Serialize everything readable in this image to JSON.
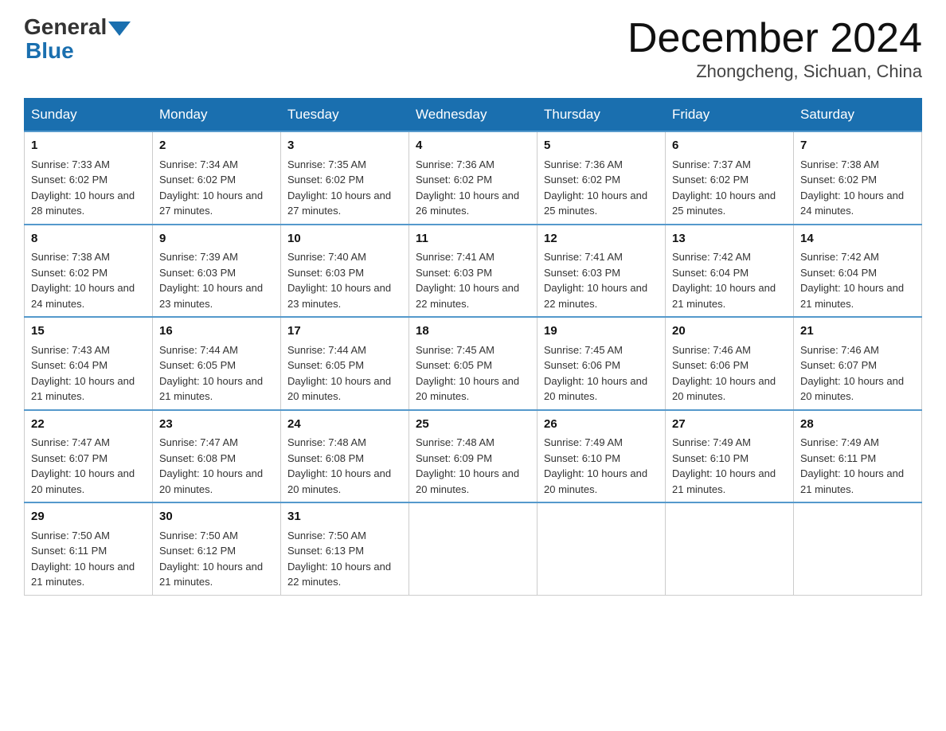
{
  "header": {
    "logo_text_general": "General",
    "logo_text_blue": "Blue",
    "month_year": "December 2024",
    "location": "Zhongcheng, Sichuan, China"
  },
  "weekdays": [
    "Sunday",
    "Monday",
    "Tuesday",
    "Wednesday",
    "Thursday",
    "Friday",
    "Saturday"
  ],
  "weeks": [
    [
      {
        "day": "1",
        "sunrise": "7:33 AM",
        "sunset": "6:02 PM",
        "daylight": "10 hours and 28 minutes."
      },
      {
        "day": "2",
        "sunrise": "7:34 AM",
        "sunset": "6:02 PM",
        "daylight": "10 hours and 27 minutes."
      },
      {
        "day": "3",
        "sunrise": "7:35 AM",
        "sunset": "6:02 PM",
        "daylight": "10 hours and 27 minutes."
      },
      {
        "day": "4",
        "sunrise": "7:36 AM",
        "sunset": "6:02 PM",
        "daylight": "10 hours and 26 minutes."
      },
      {
        "day": "5",
        "sunrise": "7:36 AM",
        "sunset": "6:02 PM",
        "daylight": "10 hours and 25 minutes."
      },
      {
        "day": "6",
        "sunrise": "7:37 AM",
        "sunset": "6:02 PM",
        "daylight": "10 hours and 25 minutes."
      },
      {
        "day": "7",
        "sunrise": "7:38 AM",
        "sunset": "6:02 PM",
        "daylight": "10 hours and 24 minutes."
      }
    ],
    [
      {
        "day": "8",
        "sunrise": "7:38 AM",
        "sunset": "6:02 PM",
        "daylight": "10 hours and 24 minutes."
      },
      {
        "day": "9",
        "sunrise": "7:39 AM",
        "sunset": "6:03 PM",
        "daylight": "10 hours and 23 minutes."
      },
      {
        "day": "10",
        "sunrise": "7:40 AM",
        "sunset": "6:03 PM",
        "daylight": "10 hours and 23 minutes."
      },
      {
        "day": "11",
        "sunrise": "7:41 AM",
        "sunset": "6:03 PM",
        "daylight": "10 hours and 22 minutes."
      },
      {
        "day": "12",
        "sunrise": "7:41 AM",
        "sunset": "6:03 PM",
        "daylight": "10 hours and 22 minutes."
      },
      {
        "day": "13",
        "sunrise": "7:42 AM",
        "sunset": "6:04 PM",
        "daylight": "10 hours and 21 minutes."
      },
      {
        "day": "14",
        "sunrise": "7:42 AM",
        "sunset": "6:04 PM",
        "daylight": "10 hours and 21 minutes."
      }
    ],
    [
      {
        "day": "15",
        "sunrise": "7:43 AM",
        "sunset": "6:04 PM",
        "daylight": "10 hours and 21 minutes."
      },
      {
        "day": "16",
        "sunrise": "7:44 AM",
        "sunset": "6:05 PM",
        "daylight": "10 hours and 21 minutes."
      },
      {
        "day": "17",
        "sunrise": "7:44 AM",
        "sunset": "6:05 PM",
        "daylight": "10 hours and 20 minutes."
      },
      {
        "day": "18",
        "sunrise": "7:45 AM",
        "sunset": "6:05 PM",
        "daylight": "10 hours and 20 minutes."
      },
      {
        "day": "19",
        "sunrise": "7:45 AM",
        "sunset": "6:06 PM",
        "daylight": "10 hours and 20 minutes."
      },
      {
        "day": "20",
        "sunrise": "7:46 AM",
        "sunset": "6:06 PM",
        "daylight": "10 hours and 20 minutes."
      },
      {
        "day": "21",
        "sunrise": "7:46 AM",
        "sunset": "6:07 PM",
        "daylight": "10 hours and 20 minutes."
      }
    ],
    [
      {
        "day": "22",
        "sunrise": "7:47 AM",
        "sunset": "6:07 PM",
        "daylight": "10 hours and 20 minutes."
      },
      {
        "day": "23",
        "sunrise": "7:47 AM",
        "sunset": "6:08 PM",
        "daylight": "10 hours and 20 minutes."
      },
      {
        "day": "24",
        "sunrise": "7:48 AM",
        "sunset": "6:08 PM",
        "daylight": "10 hours and 20 minutes."
      },
      {
        "day": "25",
        "sunrise": "7:48 AM",
        "sunset": "6:09 PM",
        "daylight": "10 hours and 20 minutes."
      },
      {
        "day": "26",
        "sunrise": "7:49 AM",
        "sunset": "6:10 PM",
        "daylight": "10 hours and 20 minutes."
      },
      {
        "day": "27",
        "sunrise": "7:49 AM",
        "sunset": "6:10 PM",
        "daylight": "10 hours and 21 minutes."
      },
      {
        "day": "28",
        "sunrise": "7:49 AM",
        "sunset": "6:11 PM",
        "daylight": "10 hours and 21 minutes."
      }
    ],
    [
      {
        "day": "29",
        "sunrise": "7:50 AM",
        "sunset": "6:11 PM",
        "daylight": "10 hours and 21 minutes."
      },
      {
        "day": "30",
        "sunrise": "7:50 AM",
        "sunset": "6:12 PM",
        "daylight": "10 hours and 21 minutes."
      },
      {
        "day": "31",
        "sunrise": "7:50 AM",
        "sunset": "6:13 PM",
        "daylight": "10 hours and 22 minutes."
      },
      null,
      null,
      null,
      null
    ]
  ]
}
